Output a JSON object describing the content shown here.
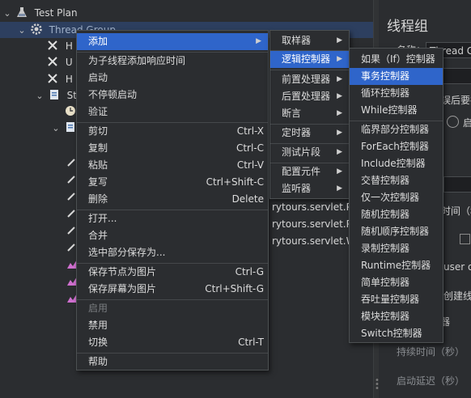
{
  "tree": {
    "test_plan": "Test Plan",
    "thread_group": "Thread Group",
    "h1": "H",
    "h2": "U",
    "h3": "H",
    "st": "St",
    "url1": "rytours.servlet.Pur",
    "url2": "rytours.servlet.Pur",
    "url3": "rytours.servlet.We"
  },
  "right_panel": {
    "title": "线程组",
    "name_label": "名称：",
    "name_value": "Thread Grou",
    "action_partial": "误后要执",
    "radio_label": "启",
    "ramp_time_partial": "时间（秒",
    "same_user_partial": "user on",
    "delay_create_partial": "创建线程",
    "partial_s": "器",
    "duration_label": "持续时间（秒）",
    "startup_delay_label": "启动延迟（秒）"
  },
  "context_menu": {
    "add": "添加",
    "add_think_time": "为子线程添加响应时间",
    "start": "启动",
    "start_no_pause": "不停顿启动",
    "validate": "验证",
    "cut": "剪切",
    "cut_shortcut": "Ctrl-X",
    "copy": "复制",
    "copy_shortcut": "Ctrl-C",
    "paste": "粘贴",
    "paste_shortcut": "Ctrl-V",
    "duplicate": "复写",
    "duplicate_shortcut": "Ctrl+Shift-C",
    "delete": "删除",
    "delete_shortcut": "Delete",
    "open": "打开...",
    "merge": "合并",
    "save_selection_as": "选中部分保存为...",
    "save_node_image": "保存节点为图片",
    "save_node_image_shortcut": "Ctrl-G",
    "save_screen_image": "保存屏幕为图片",
    "save_screen_image_shortcut": "Ctrl+Shift-G",
    "enable": "启用",
    "disable": "禁用",
    "toggle": "切换",
    "toggle_shortcut": "Ctrl-T",
    "help": "帮助"
  },
  "add_submenu": {
    "sampler": "取样器",
    "logic_controller": "逻辑控制器",
    "pre_processors": "前置处理器",
    "post_processors": "后置处理器",
    "assertions": "断言",
    "timer": "定时器",
    "test_fragment": "测试片段",
    "config_element": "配置元件",
    "listener": "监听器"
  },
  "logic_submenu": {
    "items": [
      "如果（If）控制器",
      "事务控制器",
      "循环控制器",
      "While控制器",
      "临界部分控制器",
      "ForEach控制器",
      "Include控制器",
      "交替控制器",
      "仅一次控制器",
      "随机控制器",
      "随机顺序控制器",
      "录制控制器",
      "Runtime控制器",
      "简单控制器",
      "吞吐量控制器",
      "模块控制器",
      "Switch控制器"
    ]
  },
  "colors": {
    "highlight": "#2f65ca",
    "background": "#2b2d30",
    "tree_selection": "#2d3f5f"
  }
}
